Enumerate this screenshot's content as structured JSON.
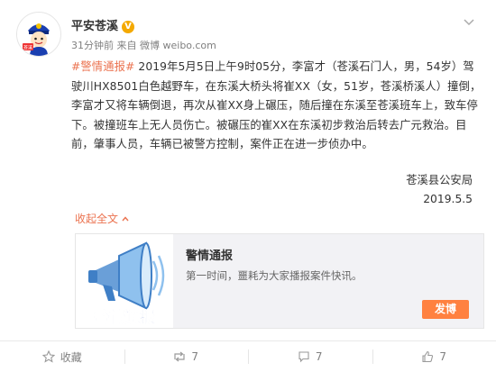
{
  "post": {
    "author": "平安苍溪",
    "verified_mark": "V",
    "time": "31分钟前",
    "source": "来自 微博 weibo.com",
    "hashtag": "#警情通报#",
    "content": " 2019年5月5日上午9时05分，李富才（苍溪石门人，男，54岁）驾驶川HX8501白色越野车，在东溪大桥头将崔XX（女，51岁，苍溪桥溪人）撞倒，李富才又将车辆倒退，再次从崔XX身上碾压，随后撞在东溪至苍溪班车上，致车停下。被撞班车上无人员伤亡。被碾压的崔XX在东溪初步救治后转去广元救治。目前，肇事人员，车辆已被警方控制，案件正在进一步侦办中。",
    "signature": "苍溪县公安局",
    "date": "2019.5.5",
    "collapse_label": "收起全文",
    "avatar_text": "苍溪"
  },
  "card": {
    "title": "警情通报",
    "description": "第一时间，噩耗为大家播报案件快讯。",
    "image_text": "警情通报",
    "button_label": "发博"
  },
  "actions": {
    "favorite_label": "收藏",
    "repost_count": "7",
    "comment_count": "7",
    "like_count": "7"
  },
  "colors": {
    "accent": "#eb7350",
    "button": "#ff8140",
    "verified": "#f4a900",
    "police_blue": "#1a3fb0"
  }
}
